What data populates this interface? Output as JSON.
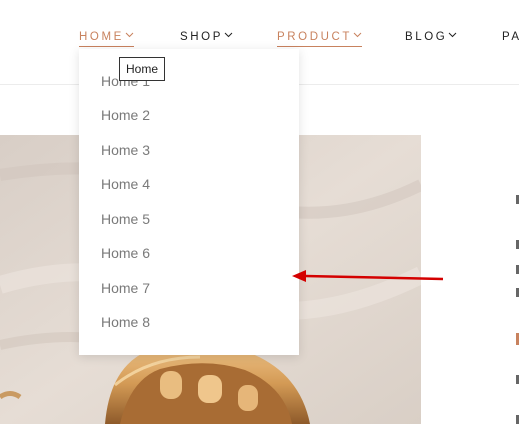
{
  "nav": {
    "items": [
      {
        "label": "HOME",
        "has_dropdown": true,
        "active": true
      },
      {
        "label": "SHOP",
        "has_dropdown": true,
        "active": false
      },
      {
        "label": "PRODUCT",
        "has_dropdown": true,
        "active": true
      },
      {
        "label": "BLOG",
        "has_dropdown": true,
        "active": false
      },
      {
        "label": "PA",
        "has_dropdown": false,
        "active": false
      }
    ]
  },
  "dropdown": {
    "items": [
      "Home 1",
      "Home 2",
      "Home 3",
      "Home 4",
      "Home 5",
      "Home 6",
      "Home 7",
      "Home 8"
    ]
  },
  "tooltip": {
    "text": "Home"
  },
  "colors": {
    "accent": "#c8825e",
    "annotation_arrow": "#d40000",
    "text_dark": "#222222",
    "text_muted": "#7a7a7a"
  }
}
